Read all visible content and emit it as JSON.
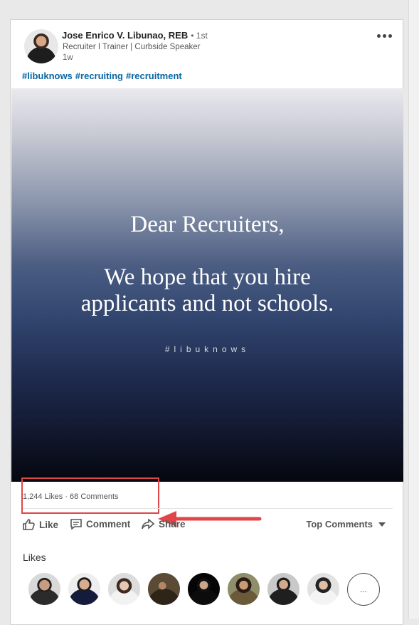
{
  "post": {
    "author_name": "Jose Enrico V. Libunao, REB",
    "degree": "• 1st",
    "headline": "Recruiter I Trainer | Curbside Speaker",
    "time": "1w",
    "hashtags": [
      "#libuknows",
      "#recruiting",
      "#recruitment"
    ]
  },
  "media": {
    "line1": "Dear Recruiters,",
    "line2a": "We hope that you hire",
    "line2b": "applicants and not schools.",
    "tag": "#libuknows"
  },
  "stats": {
    "likes": "1,244 Likes",
    "separator": " · ",
    "comments": "68 Comments"
  },
  "actions": {
    "like": "Like",
    "comment": "Comment",
    "share": "Share",
    "sort": "Top Comments"
  },
  "likes_section": {
    "title": "Likes",
    "more": "...",
    "avatars": [
      "avatar-1",
      "avatar-2",
      "avatar-3",
      "avatar-4",
      "avatar-5",
      "avatar-6",
      "avatar-7",
      "avatar-8"
    ]
  },
  "colors": {
    "link": "#0a66a2",
    "highlight": "#e0454a"
  }
}
